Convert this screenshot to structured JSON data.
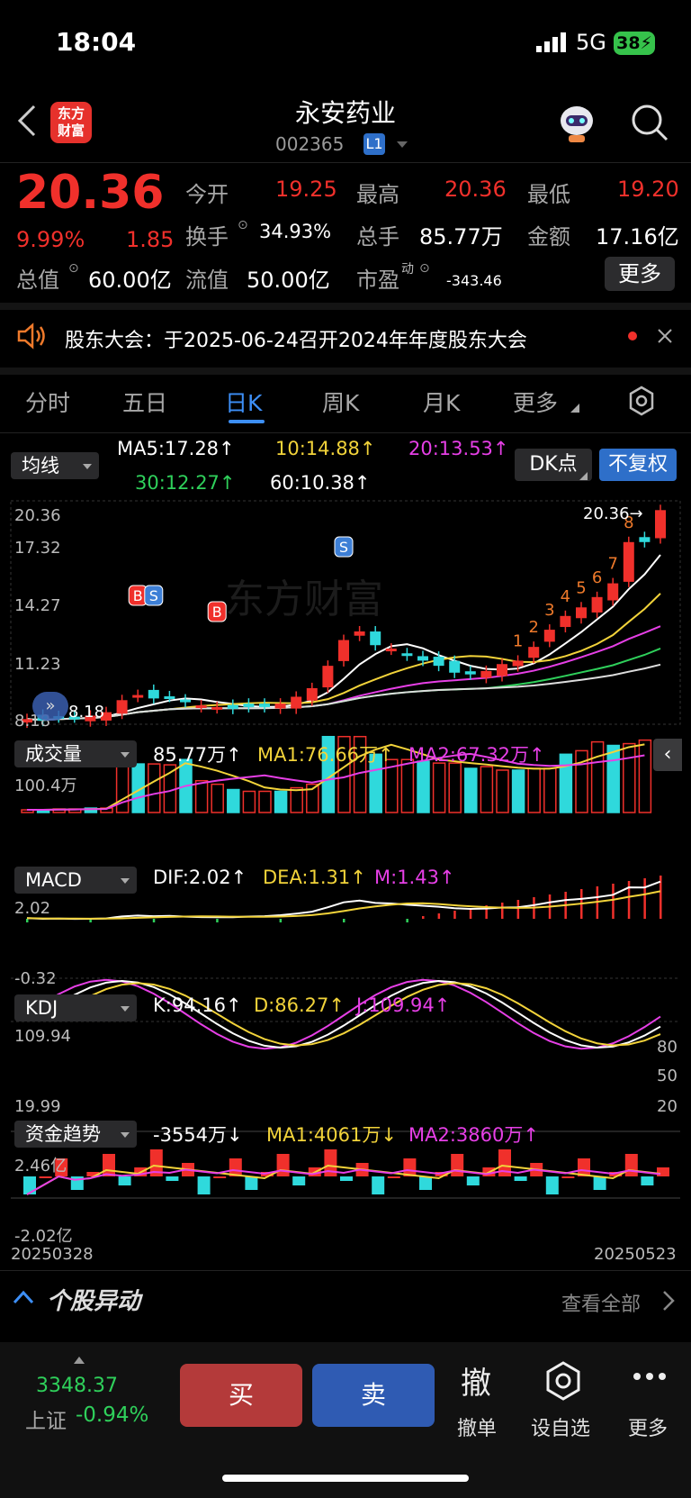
{
  "status": {
    "time": "18:04",
    "network": "5G",
    "battery": "38"
  },
  "header": {
    "logo_line1": "东方",
    "logo_line2": "财富",
    "title": "永安药业",
    "code": "002365",
    "level": "L1"
  },
  "quote": {
    "price": "20.36",
    "change_pct": "9.99%",
    "change": "1.85",
    "open_label": "今开",
    "open": "19.25",
    "high_label": "最高",
    "high": "20.36",
    "low_label": "最低",
    "low": "19.20",
    "turnover_label": "换手",
    "turnover": "34.93%",
    "volume_label": "总手",
    "volume": "85.77万",
    "amount_label": "金额",
    "amount": "17.16亿",
    "mktcap_label": "总值",
    "mktcap": "60.00亿",
    "float_label": "流值",
    "float": "50.00亿",
    "pe_label": "市盈",
    "pe_sup": "动",
    "pe": "-343.46",
    "more": "更多"
  },
  "notice": {
    "text": "股东大会：于2025-06-24召开2024年年度股东大会"
  },
  "tabs": [
    "分时",
    "五日",
    "日K",
    "周K",
    "月K",
    "更多"
  ],
  "chart": {
    "ma_label": "均线",
    "ma5": "MA5:17.28",
    "ma10": "10:14.88",
    "ma20": "20:13.53",
    "ma30": "30:12.27",
    "ma60": "60:10.38",
    "dk": "DK点",
    "fuquan": "不复权",
    "price_ticks": [
      "20.36",
      "17.32",
      "14.27",
      "11.23",
      "8.18"
    ],
    "last_price_tag": "20.36→",
    "low_tag": "8.18",
    "vol_label": "成交量",
    "vol": "85.77万",
    "vol_ma1": "MA1:76.66万",
    "vol_ma2": "MA2:67.32万",
    "vol_max": "100.4万",
    "macd_label": "MACD",
    "dif": "DIF:2.02",
    "dea": "DEA:1.31",
    "m": "M:1.43",
    "macd_max": "2.02",
    "macd_min": "-0.32",
    "kdj_label": "KDJ",
    "k": "K:94.16",
    "d": "D:86.27",
    "j": "J:109.94",
    "kdj_max": "109.94",
    "kdj_min": "19.99",
    "kdj_80": "80",
    "kdj_50": "50",
    "kdj_20": "20",
    "fund_label": "资金趋势",
    "fund": "-3554万",
    "fund_ma1": "MA1:4061万",
    "fund_ma2": "MA2:3860万",
    "fund_max": "2.46亿",
    "fund_min": "-2.02亿",
    "date_start": "20250328",
    "date_end": "20250523",
    "watermark": "东方财富",
    "markers": {
      "b": "B",
      "s": "S",
      "n1": "1",
      "n2": "2",
      "n3": "3",
      "n4": "4",
      "n5": "5",
      "n6": "6",
      "n7": "7",
      "n8": "8"
    }
  },
  "news": {
    "title": "个股异动",
    "link": "查看全部"
  },
  "footer": {
    "index_value": "3348.37",
    "index_name": "上证",
    "index_change": "-0.94%",
    "buy": "买",
    "sell": "卖",
    "cancel_icon": "撤",
    "cancel": "撤单",
    "watch": "设自选",
    "more": "更多"
  },
  "colors": {
    "up": "#f0302b",
    "down": "#2fd9dc",
    "accent": "#3d8ff7"
  }
}
